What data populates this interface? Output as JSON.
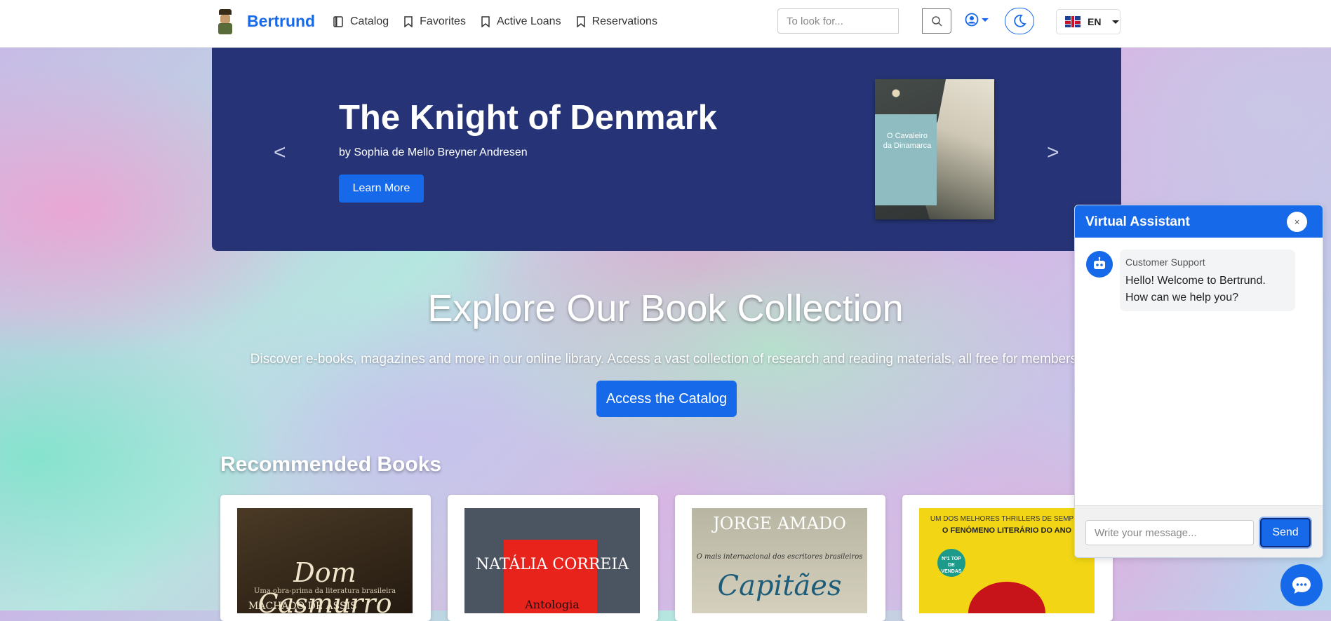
{
  "brand": {
    "name": "Bertrund"
  },
  "nav": {
    "items": [
      {
        "label": "Catalog",
        "icon": "book-icon"
      },
      {
        "label": "Favorites",
        "icon": "bookmark-icon"
      },
      {
        "label": "Active Loans",
        "icon": "bookmark-icon"
      },
      {
        "label": "Reservations",
        "icon": "bookmark-icon"
      }
    ]
  },
  "search": {
    "placeholder": "To look for..."
  },
  "language": {
    "code": "EN"
  },
  "hero": {
    "title": "The Knight of Denmark",
    "author": "by Sophia de Mello Breyner Andresen",
    "button": "Learn More",
    "prev": "<",
    "next": ">",
    "cover_title": "O Cavaleiro da Dinamarca"
  },
  "explore": {
    "title": "Explore Our Book Collection",
    "description": "Discover e-books, magazines and more in our online library. Access a vast collection of research and reading materials, all free for members.",
    "button": "Access the Catalog"
  },
  "recommended": {
    "title": "Recommended Books",
    "books": [
      {
        "title": "Dom Casmurro",
        "subtitle": "Uma obra-prima da literatura brasileira",
        "author": "MACHADO DE ASSIS"
      },
      {
        "title": "NATÁLIA CORREIA",
        "subtitle": "Antologia"
      },
      {
        "author": "JORGE AMADO",
        "subtitle": "O mais internacional dos escritores brasileiros",
        "title": "Capitães"
      },
      {
        "banner": "UM DOS MELHORES THRILLERS DE SEMPRE",
        "subtitle": "O FENÓMENO LITERÁRIO DO ANO",
        "badge": "Nº1 TOP DE VENDAS"
      }
    ]
  },
  "chat": {
    "title": "Virtual Assistant",
    "close": "×",
    "sender": "Customer Support",
    "message": "Hello! Welcome to Bertrund. How can we help you?",
    "input_placeholder": "Write your message...",
    "send": "Send"
  },
  "colors": {
    "accent": "#1669e8",
    "hero_bg": "#263477"
  }
}
